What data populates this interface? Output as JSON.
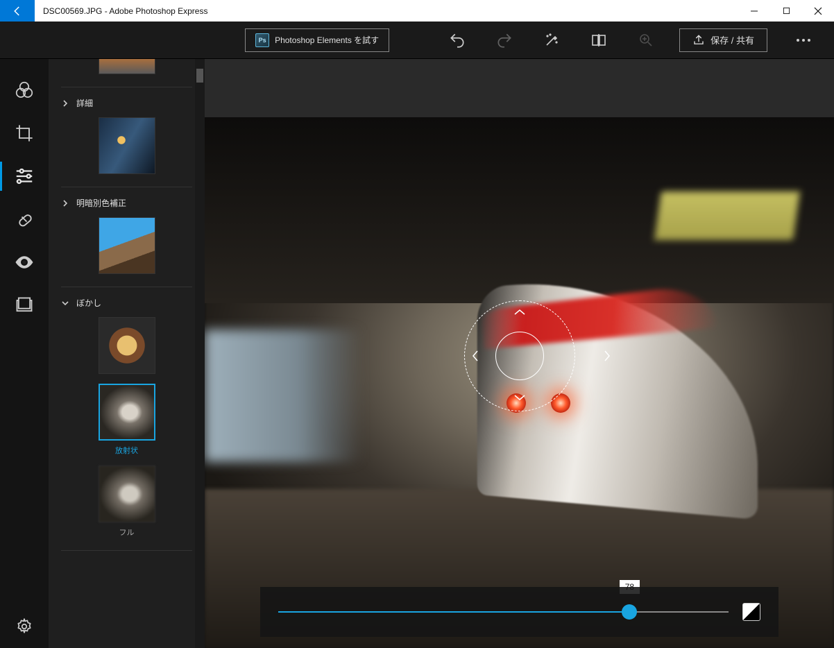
{
  "titlebar": {
    "title": "DSC00569.JPG - Adobe Photoshop Express"
  },
  "toolbar": {
    "try_label": "Photoshop Elements を試す",
    "save_label": "保存 / 共有"
  },
  "panel": {
    "sections": {
      "details": {
        "label": "詳細"
      },
      "shadows": {
        "label": "明暗別色補正"
      },
      "blur": {
        "label": "ぼかし"
      }
    },
    "blur_presets": {
      "radial": {
        "label": "放射状"
      },
      "full": {
        "label": "フル"
      }
    }
  },
  "slider": {
    "value": "78",
    "percent": 78
  }
}
